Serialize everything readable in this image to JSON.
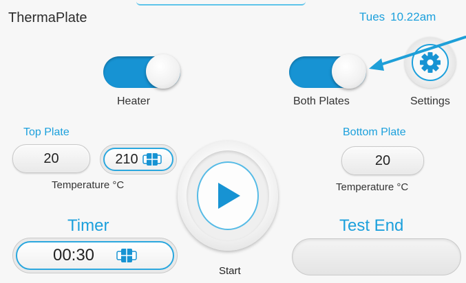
{
  "app": {
    "title": "ThermaPlate"
  },
  "clock": {
    "day": "Tues",
    "time": "10.22am"
  },
  "toggles": {
    "heater": {
      "label": "Heater",
      "on": true
    },
    "both_plates": {
      "label": "Both Plates",
      "on": true
    }
  },
  "settings": {
    "label": "Settings",
    "icon": "gear-icon"
  },
  "top_plate": {
    "heading": "Top Plate",
    "current_temp": "20",
    "set_temp": "210",
    "unit_label": "Temperature °C"
  },
  "bottom_plate": {
    "heading": "Bottom Plate",
    "current_temp": "20",
    "unit_label": "Temperature °C"
  },
  "timer": {
    "heading": "Timer",
    "value": "00:30"
  },
  "start": {
    "label": "Start",
    "icon": "play-icon"
  },
  "test_end": {
    "heading": "Test End",
    "value": ""
  },
  "colors": {
    "accent": "#1ca0dc",
    "toggle_on": "#1793d3",
    "annotation_arrow": "#1e9fd8"
  }
}
